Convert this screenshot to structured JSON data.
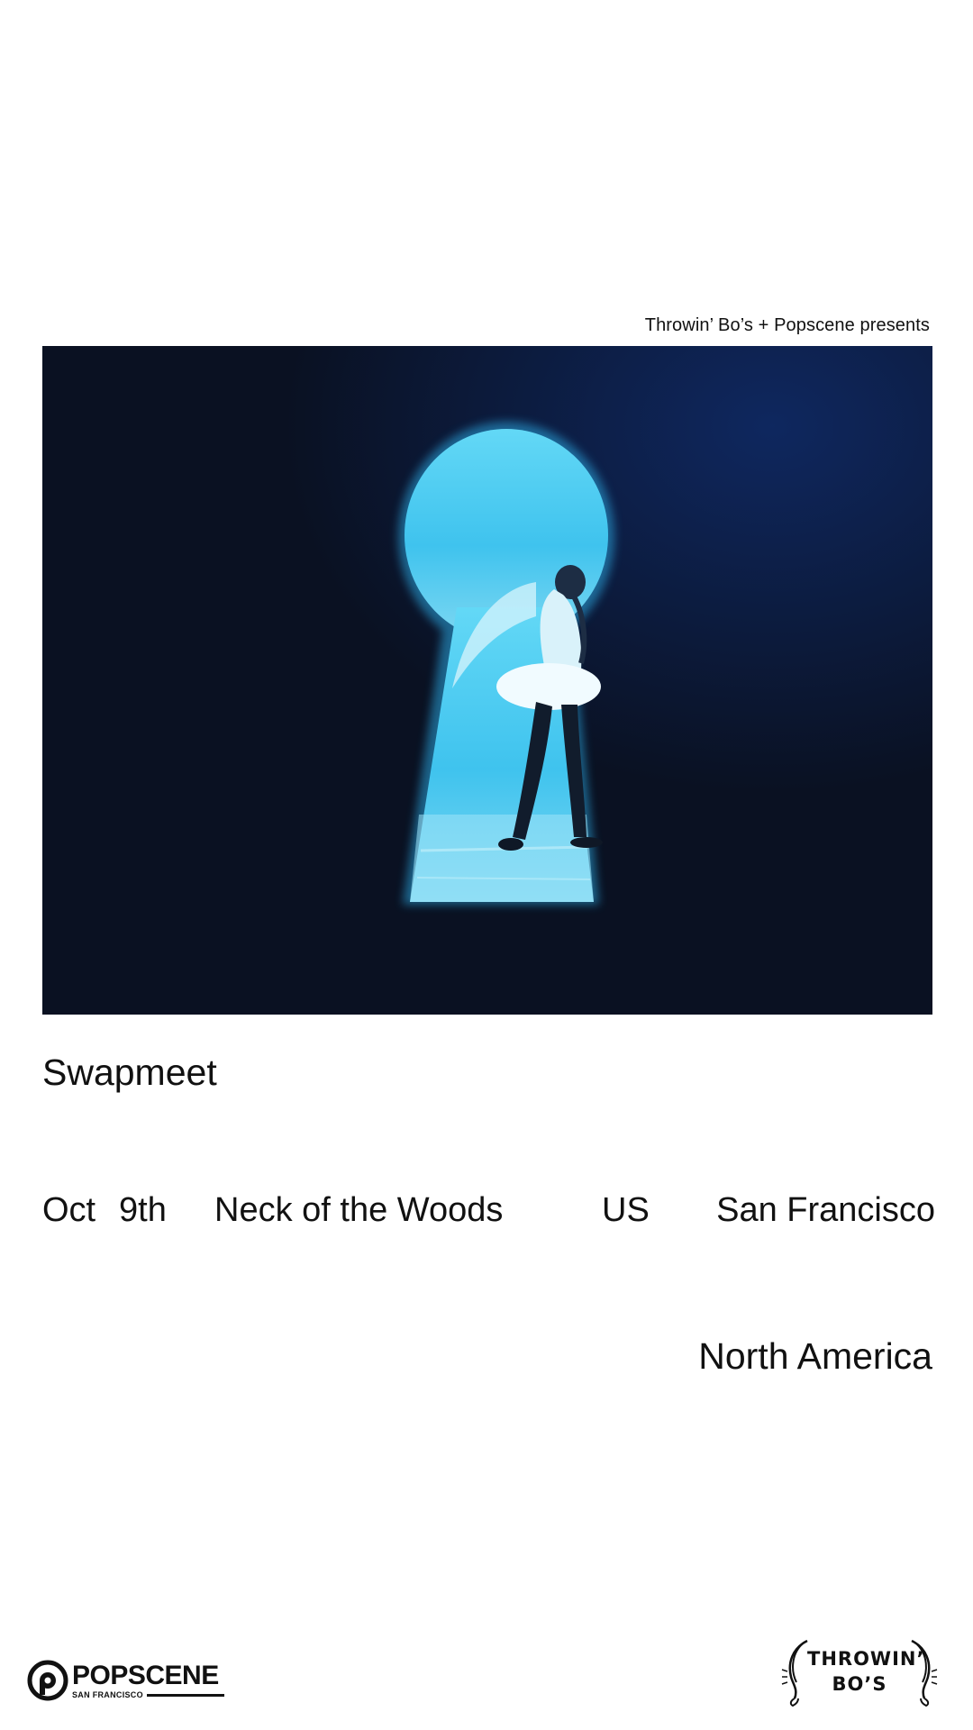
{
  "header": {
    "presents": "Throwin’ Bo’s + Popscene presents"
  },
  "event": {
    "title": "Swapmeet",
    "month": "Oct",
    "day": "9th",
    "venue": "Neck of the Woods",
    "country": "US",
    "city": "San Francisco",
    "region": "North America"
  },
  "logos": {
    "popscene_name": "POPSCENE",
    "popscene_sub": "SAN FRANCISCO",
    "throwin_bos_line1": "THROWIN’",
    "throwin_bos_line2": "BO’S"
  },
  "colors": {
    "background": "#ffffff",
    "text": "#111111",
    "poster_dark": "#0a1224",
    "keyhole_light": "#4fd2f5"
  },
  "icons": {
    "poster": "keyhole-silhouette-image",
    "popscene_mark": "popscene-circle-p-icon",
    "throwin_bos_mark": "throwin-bos-hands-icon"
  }
}
